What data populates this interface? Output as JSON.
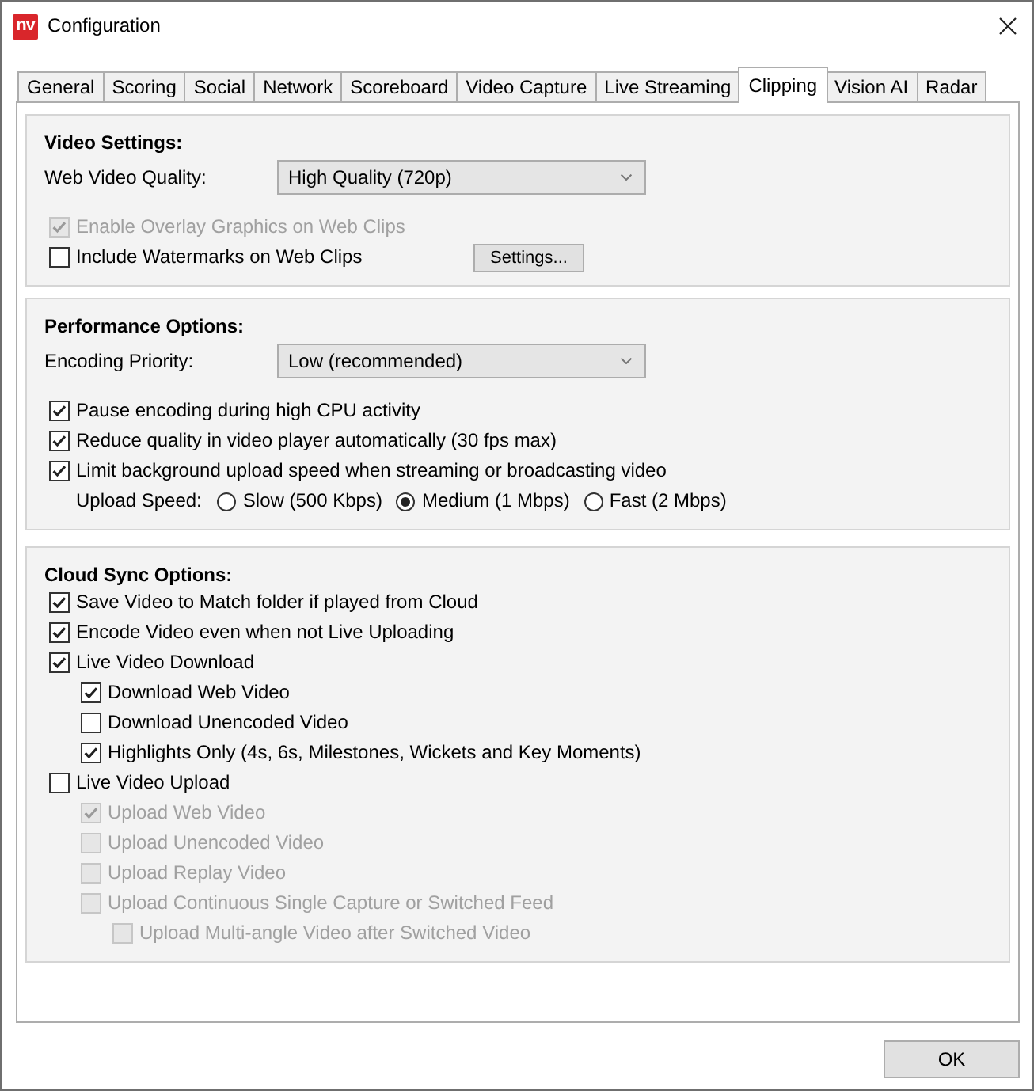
{
  "window": {
    "logo_text": "nv",
    "title": "Configuration"
  },
  "tabs": [
    {
      "label": "General",
      "selected": false
    },
    {
      "label": "Scoring",
      "selected": false
    },
    {
      "label": "Social",
      "selected": false
    },
    {
      "label": "Network",
      "selected": false
    },
    {
      "label": "Scoreboard",
      "selected": false
    },
    {
      "label": "Video Capture",
      "selected": false
    },
    {
      "label": "Live Streaming",
      "selected": false
    },
    {
      "label": "Clipping",
      "selected": true
    },
    {
      "label": "Vision AI",
      "selected": false
    },
    {
      "label": "Radar",
      "selected": false
    }
  ],
  "groups": [
    {
      "title": "Video Settings:",
      "items": [
        {
          "kind": "dropdown",
          "label": "Web Video Quality:",
          "value": "High Quality (720p)"
        },
        {
          "kind": "checkbox",
          "label": "Enable Overlay Graphics on Web Clips",
          "checked": true,
          "disabled": true
        },
        {
          "kind": "checkbox",
          "label": "Include Watermarks on Web Clips",
          "checked": false,
          "disabled": false,
          "button": "Settings..."
        }
      ]
    },
    {
      "title": "Performance Options:",
      "items": [
        {
          "kind": "dropdown",
          "label": "Encoding Priority:",
          "value": "Low (recommended)"
        },
        {
          "kind": "checkbox",
          "label": "Pause encoding during high CPU activity",
          "checked": true,
          "disabled": false
        },
        {
          "kind": "checkbox",
          "label": "Reduce quality in video player automatically (30 fps max)",
          "checked": true,
          "disabled": false
        },
        {
          "kind": "checkbox",
          "label": "Limit background upload speed when streaming or broadcasting video",
          "checked": true,
          "disabled": false,
          "children": [
            {
              "kind": "radio_group",
              "label": "Upload Speed:",
              "options": [
                {
                  "label": "Slow (500 Kbps)",
                  "selected": false
                },
                {
                  "label": "Medium (1 Mbps)",
                  "selected": true
                },
                {
                  "label": "Fast (2 Mbps)",
                  "selected": false
                }
              ]
            }
          ]
        }
      ]
    },
    {
      "title": "Cloud Sync Options:",
      "items": [
        {
          "kind": "checkbox",
          "label": "Save Video to Match folder if played from Cloud",
          "checked": true,
          "disabled": false
        },
        {
          "kind": "checkbox",
          "label": "Encode Video even when not Live Uploading",
          "checked": true,
          "disabled": false
        },
        {
          "kind": "checkbox",
          "label": "Live Video Download",
          "checked": true,
          "disabled": false,
          "children": [
            {
              "kind": "checkbox",
              "label": "Download Web Video",
              "checked": true,
              "disabled": false
            },
            {
              "kind": "checkbox",
              "label": "Download Unencoded Video",
              "checked": false,
              "disabled": false
            },
            {
              "kind": "checkbox",
              "label": "Highlights Only (4s, 6s, Milestones, Wickets and Key Moments)",
              "checked": true,
              "disabled": false
            }
          ]
        },
        {
          "kind": "checkbox",
          "label": "Live Video Upload",
          "checked": false,
          "disabled": false,
          "children": [
            {
              "kind": "checkbox",
              "label": "Upload Web Video",
              "checked": true,
              "disabled": true
            },
            {
              "kind": "checkbox",
              "label": "Upload Unencoded Video",
              "checked": false,
              "disabled": true
            },
            {
              "kind": "checkbox",
              "label": "Upload Replay Video",
              "checked": false,
              "disabled": true
            },
            {
              "kind": "checkbox",
              "label": "Upload Continuous Single Capture or Switched Feed",
              "checked": false,
              "disabled": true,
              "children": [
                {
                  "kind": "checkbox",
                  "label": "Upload Multi-angle Video after Switched Video",
                  "checked": false,
                  "disabled": true
                }
              ]
            }
          ]
        }
      ]
    }
  ],
  "ok_button": "OK"
}
